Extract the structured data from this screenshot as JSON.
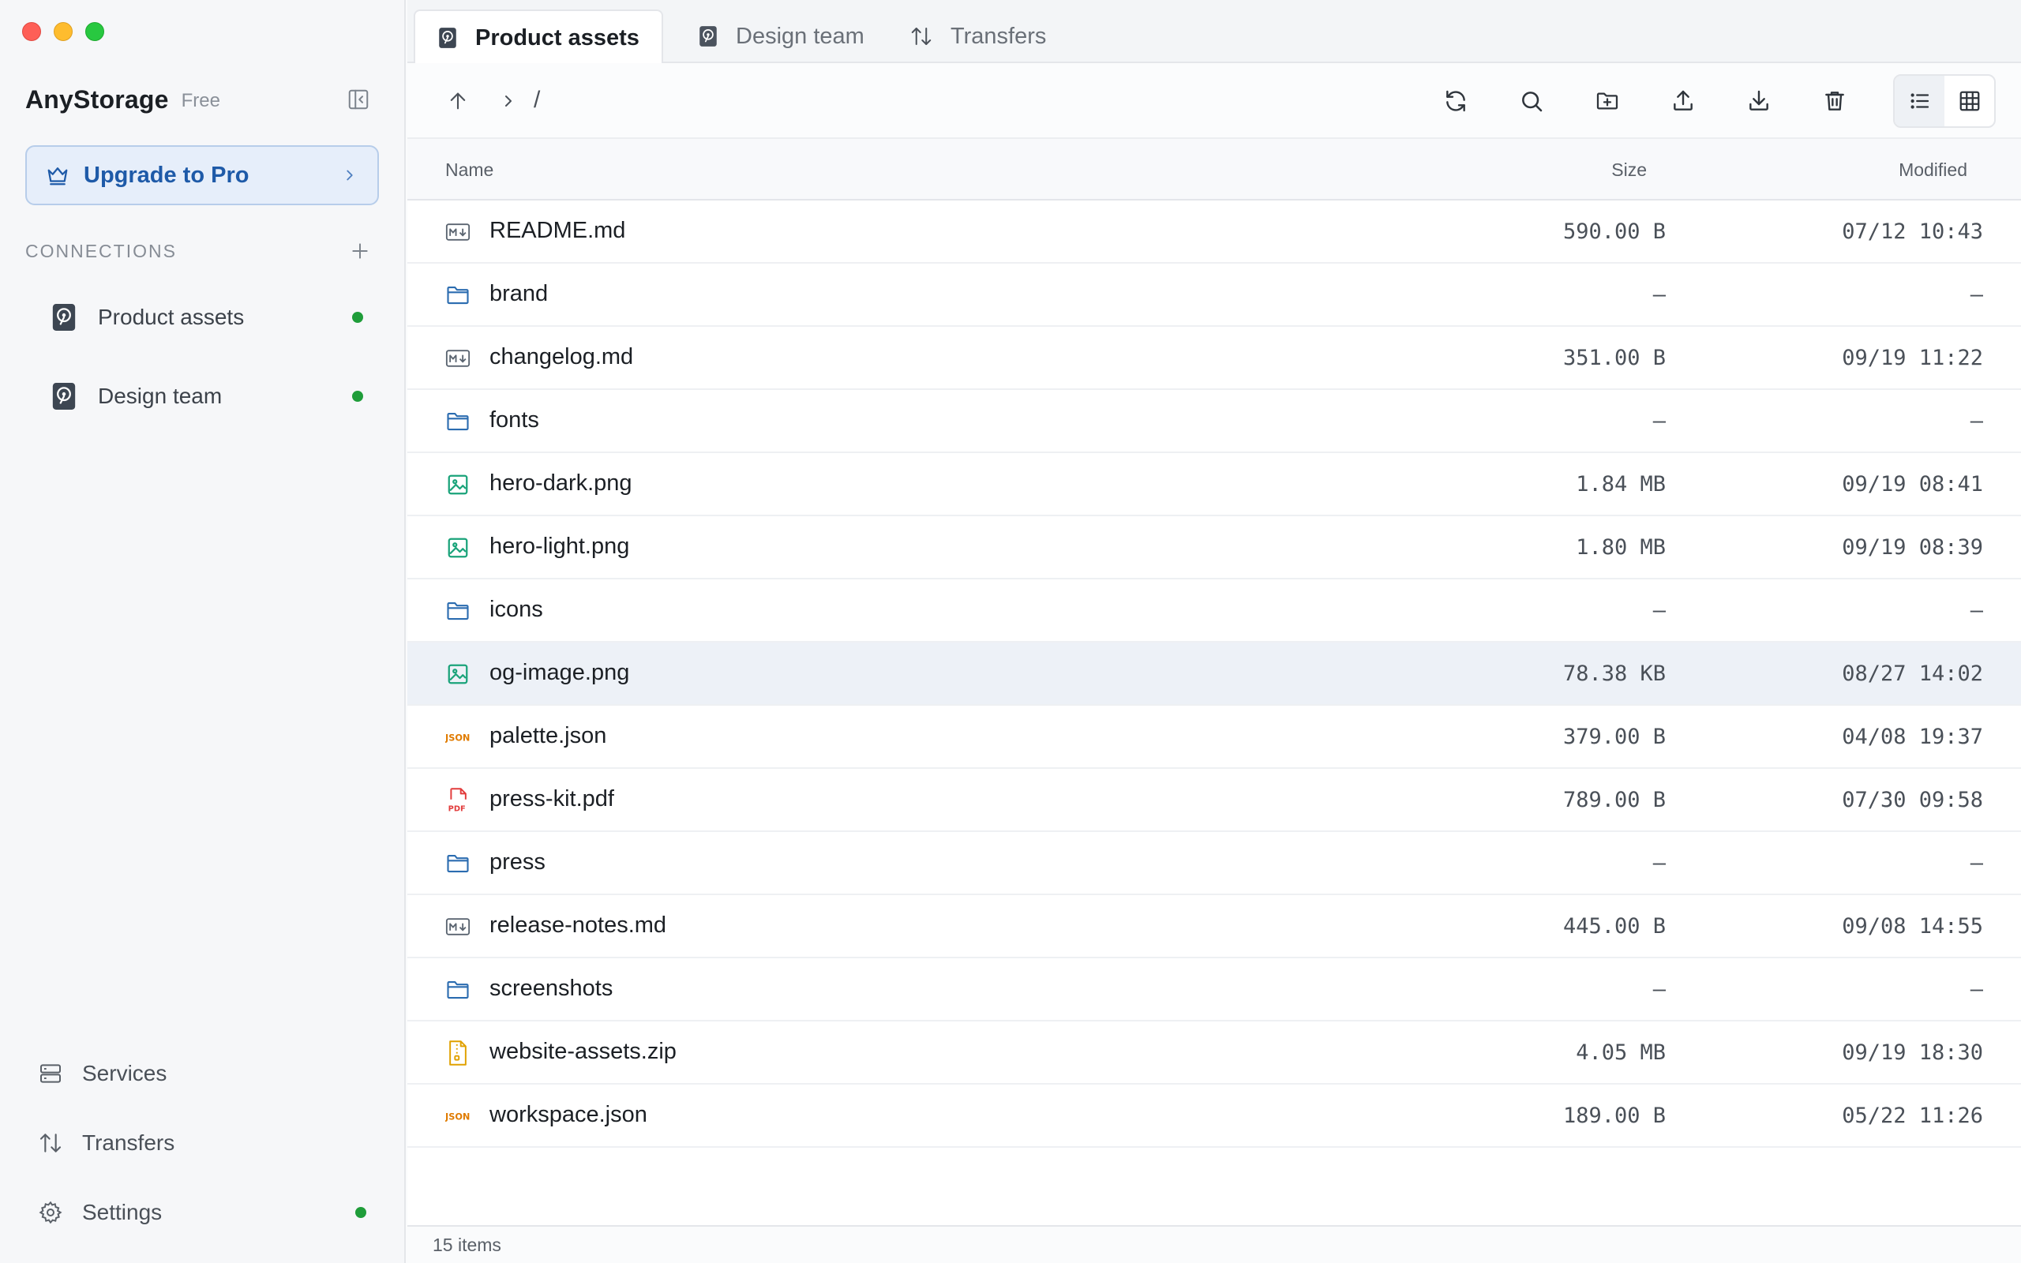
{
  "window": {
    "controls": [
      "close",
      "minimize",
      "zoom"
    ]
  },
  "sidebar": {
    "brand": "AnyStorage",
    "plan": "Free",
    "upgrade_label": "Upgrade to Pro",
    "connections_title": "CONNECTIONS",
    "connections": [
      {
        "label": "Product assets",
        "status": "connected"
      },
      {
        "label": "Design team",
        "status": "connected"
      }
    ],
    "bottom": [
      {
        "label": "Services",
        "icon": "server-icon"
      },
      {
        "label": "Transfers",
        "icon": "arrows-up-down-icon"
      },
      {
        "label": "Settings",
        "icon": "gear-icon"
      }
    ]
  },
  "tabs": [
    {
      "label": "Product assets",
      "active": true,
      "icon": "drive-icon"
    },
    {
      "label": "Design team",
      "active": false,
      "icon": "drive-icon"
    },
    {
      "label": "Transfers",
      "active": false,
      "icon": "arrows-up-down-icon"
    }
  ],
  "toolbar": {
    "path": "/",
    "actions": [
      "refresh",
      "search",
      "new-folder",
      "upload",
      "download",
      "delete"
    ],
    "view_mode": "list"
  },
  "table": {
    "columns": {
      "name": "Name",
      "size": "Size",
      "modified": "Modified"
    },
    "rows": [
      {
        "name": "README.md",
        "type": "markdown",
        "size": "590.00 B",
        "modified": "07/12 10:43"
      },
      {
        "name": "brand",
        "type": "folder",
        "size": "–",
        "modified": "–"
      },
      {
        "name": "changelog.md",
        "type": "markdown",
        "size": "351.00 B",
        "modified": "09/19 11:22"
      },
      {
        "name": "fonts",
        "type": "folder",
        "size": "–",
        "modified": "–"
      },
      {
        "name": "hero-dark.png",
        "type": "image",
        "size": "1.84 MB",
        "modified": "09/19 08:41"
      },
      {
        "name": "hero-light.png",
        "type": "image",
        "size": "1.80 MB",
        "modified": "09/19 08:39"
      },
      {
        "name": "icons",
        "type": "folder",
        "size": "–",
        "modified": "–"
      },
      {
        "name": "og-image.png",
        "type": "image",
        "size": "78.38 KB",
        "modified": "08/27 14:02",
        "selected": true
      },
      {
        "name": "palette.json",
        "type": "json",
        "size": "379.00 B",
        "modified": "04/08 19:37"
      },
      {
        "name": "press-kit.pdf",
        "type": "pdf",
        "size": "789.00 B",
        "modified": "07/30 09:58"
      },
      {
        "name": "press",
        "type": "folder",
        "size": "–",
        "modified": "–"
      },
      {
        "name": "release-notes.md",
        "type": "markdown",
        "size": "445.00 B",
        "modified": "09/08 14:55"
      },
      {
        "name": "screenshots",
        "type": "folder",
        "size": "–",
        "modified": "–"
      },
      {
        "name": "website-assets.zip",
        "type": "zip",
        "size": "4.05 MB",
        "modified": "09/19 18:30"
      },
      {
        "name": "workspace.json",
        "type": "json",
        "size": "189.00 B",
        "modified": "05/22 11:26"
      }
    ]
  },
  "status": {
    "count": "15 items"
  },
  "colors": {
    "accent": "#1e5aa8",
    "online": "#1f9d3a",
    "folder": "#2b6cb0",
    "image": "#1aa37a",
    "json": "#e07b00",
    "pdf": "#e23c3c",
    "zip": "#e0a100",
    "markdown": "#5a6470"
  }
}
